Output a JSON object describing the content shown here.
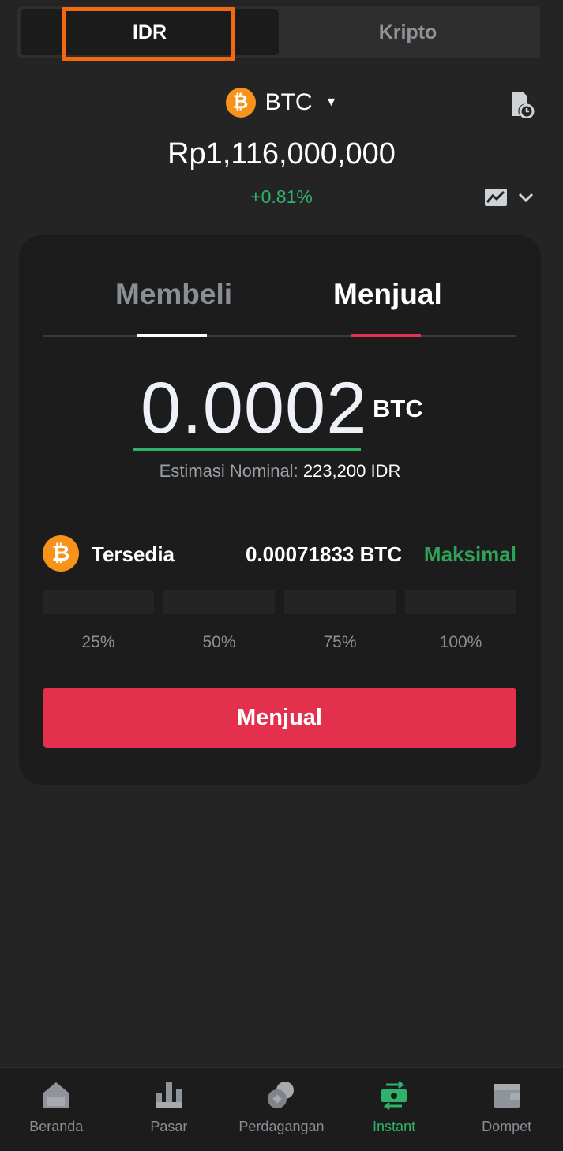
{
  "top_tabs": [
    {
      "label": "IDR",
      "active": true
    },
    {
      "label": "Kripto",
      "active": false
    }
  ],
  "coin": {
    "symbol_glyph": "₿",
    "name": "BTC",
    "icon": "bitcoin-icon"
  },
  "price": "Rp1,116,000,000",
  "change": "+0.81%",
  "trade": {
    "tabs": {
      "buy": "Membeli",
      "sell": "Menjual",
      "active": "sell"
    },
    "amount": "0.0002",
    "amount_unit": "BTC",
    "estimate_label": "Estimasi Nominal:",
    "estimate_value": "223,200 IDR",
    "available_label": "Tersedia",
    "available_value": "0.00071833 BTC",
    "max_label": "Maksimal",
    "percent_options": [
      "25%",
      "50%",
      "75%",
      "100%"
    ],
    "submit_label": "Menjual"
  },
  "nav": [
    {
      "label": "Beranda",
      "icon": "home-icon",
      "active": false
    },
    {
      "label": "Pasar",
      "icon": "market-bars-icon",
      "active": false
    },
    {
      "label": "Perdagangan",
      "icon": "trade-coins-icon",
      "active": false
    },
    {
      "label": "Instant",
      "icon": "instant-exchange-icon",
      "active": true
    },
    {
      "label": "Dompet",
      "icon": "wallet-icon",
      "active": false
    }
  ],
  "colors": {
    "background": "#242424",
    "card": "#1c1c1c",
    "green": "#2fb36b",
    "red": "#e2304d",
    "bitcoin": "#f7931a",
    "highlight": "#f26a0f"
  }
}
